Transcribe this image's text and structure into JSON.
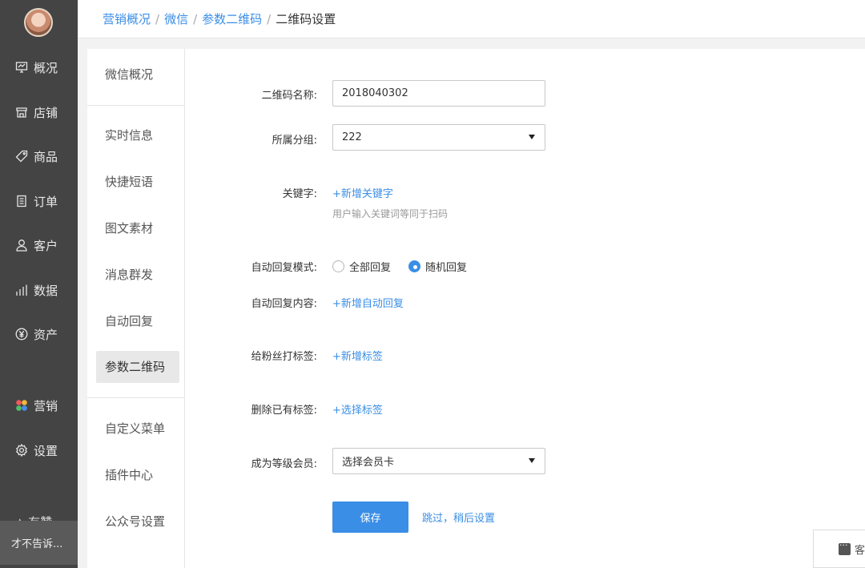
{
  "sidebar": {
    "items": [
      {
        "label": "概况",
        "icon": "monitor-icon"
      },
      {
        "label": "店铺",
        "icon": "store-icon"
      },
      {
        "label": "商品",
        "icon": "tag-icon"
      },
      {
        "label": "订单",
        "icon": "document-icon"
      },
      {
        "label": "客户",
        "icon": "person-icon"
      },
      {
        "label": "数据",
        "icon": "bar-chart-icon"
      },
      {
        "label": "资产",
        "icon": "yen-icon"
      },
      {
        "label": "营销",
        "icon": "flower-icon"
      },
      {
        "label": "设置",
        "icon": "gear-icon"
      }
    ],
    "cut_item": "△ 有赞",
    "user": "才不告诉..."
  },
  "breadcrumb": {
    "items": [
      "营销概况",
      "微信",
      "参数二维码"
    ],
    "current": "二维码设置",
    "separator": "/"
  },
  "subnav": {
    "items": [
      "微信概况",
      "实时信息",
      "快捷短语",
      "图文素材",
      "消息群发",
      "自动回复",
      "参数二维码",
      "自定义菜单",
      "插件中心",
      "公众号设置"
    ],
    "active": "参数二维码"
  },
  "form": {
    "name_label": "二维码名称:",
    "name_value": "2018040302",
    "group_label": "所属分组:",
    "group_value": "222",
    "keyword_label": "关键字:",
    "keyword_add": "+新增关键字",
    "keyword_hint": "用户输入关键词等同于扫码",
    "reply_mode_label": "自动回复模式:",
    "reply_mode_options": [
      "全部回复",
      "随机回复"
    ],
    "reply_mode_selected": "随机回复",
    "reply_content_label": "自动回复内容:",
    "reply_content_add": "+新增自动回复",
    "tag_label": "给粉丝打标签:",
    "tag_add": "+新增标签",
    "remove_tag_label": "删除已有标签:",
    "remove_tag_select": "+选择标签",
    "member_label": "成为等级会员:",
    "member_placeholder": "选择会员卡",
    "save": "保存",
    "skip": "跳过，稍后设置"
  },
  "float_chat": {
    "label": "客"
  },
  "colors": {
    "accent": "#3a8ee6",
    "sidebar_bg": "#444444"
  }
}
